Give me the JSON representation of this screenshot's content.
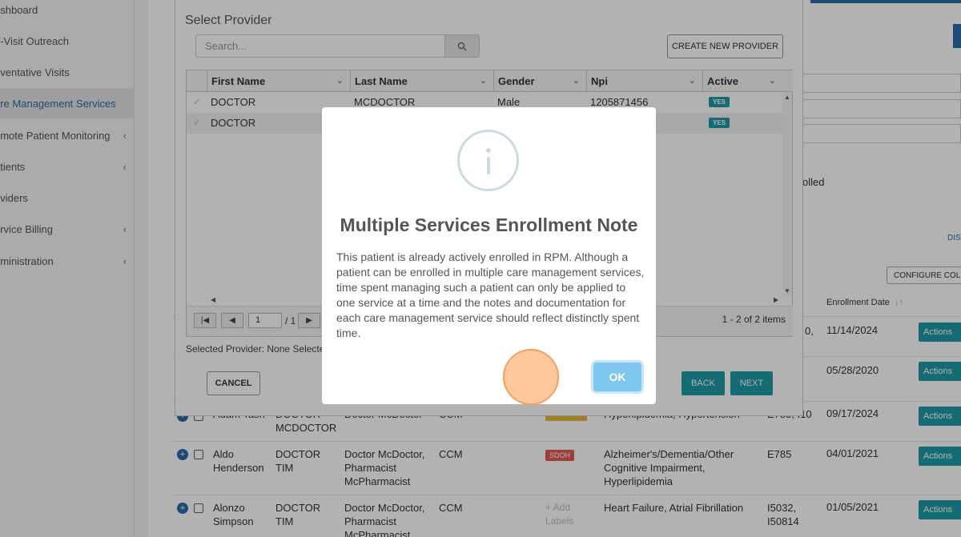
{
  "sidebar": {
    "items": [
      {
        "label": "ashboard",
        "has_chevron": false,
        "active": false
      },
      {
        "label": "e-Visit Outreach",
        "has_chevron": false,
        "active": false
      },
      {
        "label": "eventative Visits",
        "has_chevron": false,
        "active": false
      },
      {
        "label": "are Management Services",
        "has_chevron": false,
        "active": true
      },
      {
        "label": "emote Patient Monitoring",
        "has_chevron": true,
        "active": false
      },
      {
        "label": "atients",
        "has_chevron": true,
        "active": false
      },
      {
        "label": "oviders",
        "has_chevron": false,
        "active": false
      },
      {
        "label": "ervice Billing",
        "has_chevron": true,
        "active": false
      },
      {
        "label": "dministration",
        "has_chevron": true,
        "active": false
      }
    ],
    "chevron": "‹"
  },
  "background": {
    "enrolled_text": "olled",
    "dis_link": "DIS",
    "configure_button": "CONFIGURE COLU",
    "enrollment_date_header": "Enrollment Date",
    "rows": [
      {
        "date": "11/14/2024",
        "code_fragment": "0,",
        "actions": "Actions"
      },
      {
        "date": "05/28/2020",
        "actions": "Actions"
      },
      {
        "first_last": "Adam Tash",
        "provider": "DOCTOR MCDOCTOR",
        "team": "Doctor McDoctor",
        "service": "CCM",
        "conditions": "Hyperlipidemia, Hypertension",
        "codes": "E785, I10",
        "date": "09/17/2024",
        "actions": "Actions"
      },
      {
        "first": "Aldo",
        "last": "Henderson",
        "prov1": "DOCTOR",
        "prov2": "TIM",
        "team1": "Doctor McDoctor,",
        "team2": "Pharmacist",
        "team3": "McPharmacist",
        "service": "CCM",
        "tag": "SDOH",
        "cond1": "Alzheimer's/Dementia/Other",
        "cond2": "Cognitive Impairment,",
        "cond3": "Hyperlipidemia",
        "codes": "E785",
        "date": "04/01/2021",
        "actions": "Actions"
      },
      {
        "first": "Alonzo",
        "last": "Simpson",
        "prov1": "DOCTOR",
        "prov2": "TIM",
        "team1": "Doctor McDoctor,",
        "team2": "Pharmacist",
        "team3": "McPharmacist",
        "service": "CCM",
        "tag1": "+ Add",
        "tag2": "Labels",
        "cond1": "Heart Failure, Atrial Fibrillation",
        "code1": "I5032,",
        "code2": "I50814",
        "date": "01/05/2021",
        "actions": "Actions"
      }
    ]
  },
  "provider_modal": {
    "title": "Select Provider",
    "search_placeholder": "Search...",
    "create_button": "CREATE NEW PROVIDER",
    "columns": [
      "First Name",
      "Last Name",
      "Gender",
      "Npi",
      "Active"
    ],
    "rows": [
      {
        "first": "DOCTOR",
        "last": "MCDOCTOR",
        "gender": "Male",
        "npi": "1205871456",
        "active": "YES"
      },
      {
        "first": "DOCTOR",
        "last": "",
        "gender": "",
        "npi": "",
        "active": "YES"
      }
    ],
    "pager": {
      "page": "1",
      "of": "/ 1",
      "items": "1 - 2 of 2 items"
    },
    "selected_provider": "Selected Provider: None Selecte",
    "cancel_button": "CANCEL",
    "back_button": "BACK",
    "next_button": "NEXT"
  },
  "alert": {
    "title": "Multiple Services Enrollment Note",
    "text": "This patient is already actively enrolled in RPM. Although a patient can be enrolled in multiple care management services, time spent managing such a patient can only be applied to one service at a time and the notes and documentation for each care management service should reflect distinctly spent time.",
    "ok_button": "OK"
  }
}
